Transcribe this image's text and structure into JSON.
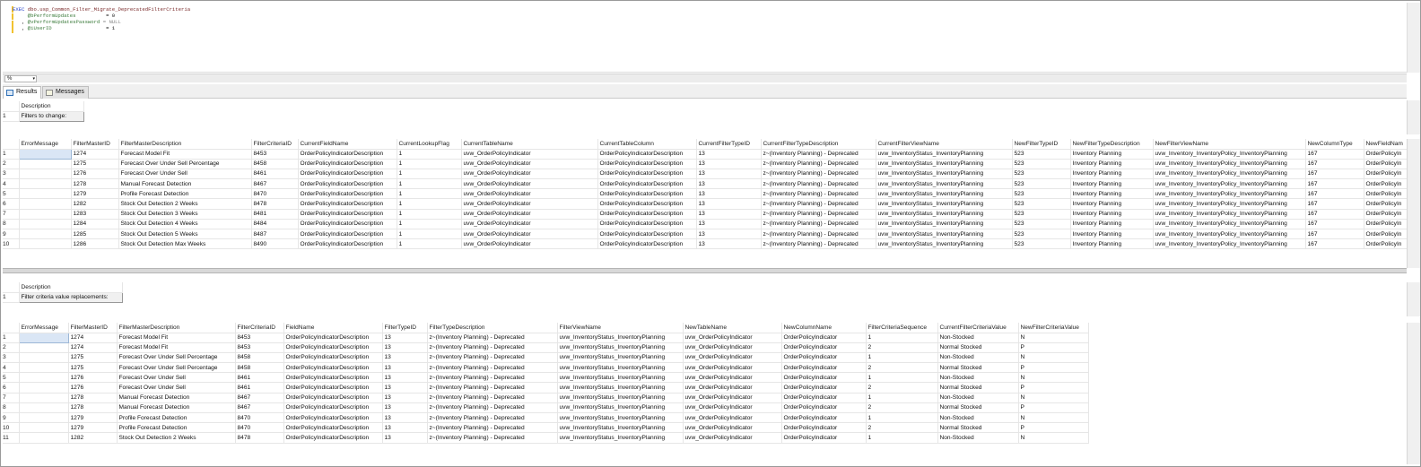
{
  "editor": {
    "line1_kw": "EXEC",
    "line1_proc": "dbo.usp_Common_Filter_Migrate_DeprecatedFilterCriteria",
    "line2_var": "@bPerformUpdates",
    "line2_val": "= 0",
    "line3_var": "@vPerformUpdatesPassword",
    "line3_val": "= NULL",
    "line4_var": "@iUserID",
    "line4_val": "= 1"
  },
  "zoom": {
    "value": "%"
  },
  "tabs": {
    "results": "Results",
    "messages": "Messages"
  },
  "grid1": {
    "header": "Description",
    "rows": [
      {
        "n": "1",
        "value": "Filters to change:"
      }
    ]
  },
  "grid2": {
    "headers": [
      "ErrorMessage",
      "FilterMasterID",
      "FilterMasterDescription",
      "FilterCriteriaID",
      "CurrentFieldName",
      "CurrentLookupFlag",
      "CurrentTableName",
      "CurrentTableColumn",
      "CurrentFilterTypeID",
      "CurrentFilterTypeDescription",
      "CurrentFilterViewName",
      "NewFilterTypeID",
      "NewFilterTypeDescription",
      "NewFilterViewName",
      "NewColumnType",
      "NewFieldNam"
    ],
    "rows": [
      [
        "1",
        "",
        "1274",
        "Forecast Model Fit",
        "8453",
        "OrderPolicyIndicatorDescription",
        "1",
        "uvw_OrderPolicyIndicator",
        "OrderPolicyIndicatorDescription",
        "13",
        "z~(Inventory Planning) - Deprecated",
        "uvw_InventoryStatus_InventoryPlanning",
        "523",
        "Inventory Planning",
        "uvw_Inventory_InventoryPolicy_InventoryPlanning",
        "167",
        "OrderPolicyIn"
      ],
      [
        "2",
        "",
        "1275",
        "Forecast Over Under Sell Percentage",
        "8458",
        "OrderPolicyIndicatorDescription",
        "1",
        "uvw_OrderPolicyIndicator",
        "OrderPolicyIndicatorDescription",
        "13",
        "z~(Inventory Planning) - Deprecated",
        "uvw_InventoryStatus_InventoryPlanning",
        "523",
        "Inventory Planning",
        "uvw_Inventory_InventoryPolicy_InventoryPlanning",
        "167",
        "OrderPolicyIn"
      ],
      [
        "3",
        "",
        "1276",
        "Forecast Over Under Sell",
        "8461",
        "OrderPolicyIndicatorDescription",
        "1",
        "uvw_OrderPolicyIndicator",
        "OrderPolicyIndicatorDescription",
        "13",
        "z~(Inventory Planning) - Deprecated",
        "uvw_InventoryStatus_InventoryPlanning",
        "523",
        "Inventory Planning",
        "uvw_Inventory_InventoryPolicy_InventoryPlanning",
        "167",
        "OrderPolicyIn"
      ],
      [
        "4",
        "",
        "1278",
        "Manual Forecast Detection",
        "8467",
        "OrderPolicyIndicatorDescription",
        "1",
        "uvw_OrderPolicyIndicator",
        "OrderPolicyIndicatorDescription",
        "13",
        "z~(Inventory Planning) - Deprecated",
        "uvw_InventoryStatus_InventoryPlanning",
        "523",
        "Inventory Planning",
        "uvw_Inventory_InventoryPolicy_InventoryPlanning",
        "167",
        "OrderPolicyIn"
      ],
      [
        "5",
        "",
        "1279",
        "Profile Forecast Detection",
        "8470",
        "OrderPolicyIndicatorDescription",
        "1",
        "uvw_OrderPolicyIndicator",
        "OrderPolicyIndicatorDescription",
        "13",
        "z~(Inventory Planning) - Deprecated",
        "uvw_InventoryStatus_InventoryPlanning",
        "523",
        "Inventory Planning",
        "uvw_Inventory_InventoryPolicy_InventoryPlanning",
        "167",
        "OrderPolicyIn"
      ],
      [
        "6",
        "",
        "1282",
        "Stock Out Detection 2 Weeks",
        "8478",
        "OrderPolicyIndicatorDescription",
        "1",
        "uvw_OrderPolicyIndicator",
        "OrderPolicyIndicatorDescription",
        "13",
        "z~(Inventory Planning) - Deprecated",
        "uvw_InventoryStatus_InventoryPlanning",
        "523",
        "Inventory Planning",
        "uvw_Inventory_InventoryPolicy_InventoryPlanning",
        "167",
        "OrderPolicyIn"
      ],
      [
        "7",
        "",
        "1283",
        "Stock Out Detection 3 Weeks",
        "8481",
        "OrderPolicyIndicatorDescription",
        "1",
        "uvw_OrderPolicyIndicator",
        "OrderPolicyIndicatorDescription",
        "13",
        "z~(Inventory Planning) - Deprecated",
        "uvw_InventoryStatus_InventoryPlanning",
        "523",
        "Inventory Planning",
        "uvw_Inventory_InventoryPolicy_InventoryPlanning",
        "167",
        "OrderPolicyIn"
      ],
      [
        "8",
        "",
        "1284",
        "Stock Out Detection 4 Weeks",
        "8484",
        "OrderPolicyIndicatorDescription",
        "1",
        "uvw_OrderPolicyIndicator",
        "OrderPolicyIndicatorDescription",
        "13",
        "z~(Inventory Planning) - Deprecated",
        "uvw_InventoryStatus_InventoryPlanning",
        "523",
        "Inventory Planning",
        "uvw_Inventory_InventoryPolicy_InventoryPlanning",
        "167",
        "OrderPolicyIn"
      ],
      [
        "9",
        "",
        "1285",
        "Stock Out Detection 5 Weeks",
        "8487",
        "OrderPolicyIndicatorDescription",
        "1",
        "uvw_OrderPolicyIndicator",
        "OrderPolicyIndicatorDescription",
        "13",
        "z~(Inventory Planning) - Deprecated",
        "uvw_InventoryStatus_InventoryPlanning",
        "523",
        "Inventory Planning",
        "uvw_Inventory_InventoryPolicy_InventoryPlanning",
        "167",
        "OrderPolicyIn"
      ],
      [
        "10",
        "",
        "1286",
        "Stock Out Detection Max Weeks",
        "8490",
        "OrderPolicyIndicatorDescription",
        "1",
        "uvw_OrderPolicyIndicator",
        "OrderPolicyIndicatorDescription",
        "13",
        "z~(Inventory Planning) - Deprecated",
        "uvw_InventoryStatus_InventoryPlanning",
        "523",
        "Inventory Planning",
        "uvw_Inventory_InventoryPolicy_InventoryPlanning",
        "167",
        "OrderPolicyIn"
      ]
    ]
  },
  "grid3": {
    "header": "Description",
    "rows": [
      {
        "n": "1",
        "value": "Filter criteria value replacements:"
      }
    ]
  },
  "grid4": {
    "headers": [
      "ErrorMessage",
      "FilterMasterID",
      "FilterMasterDescription",
      "FilterCriteriaID",
      "FieldName",
      "FilterTypeID",
      "FilterTypeDescription",
      "FilterViewName",
      "NewTableName",
      "NewColumnName",
      "FilterCriteriaSequence",
      "CurrentFilterCriteriaValue",
      "NewFilterCriteriaValue"
    ],
    "rows": [
      [
        "1",
        "",
        "1274",
        "Forecast Model Fit",
        "8453",
        "OrderPolicyIndicatorDescription",
        "13",
        "z~(Inventory Planning) - Deprecated",
        "uvw_InventoryStatus_InventoryPlanning",
        "uvw_OrderPolicyIndicator",
        "OrderPolicyIndicator",
        "1",
        "Non-Stocked",
        "N"
      ],
      [
        "2",
        "",
        "1274",
        "Forecast Model Fit",
        "8453",
        "OrderPolicyIndicatorDescription",
        "13",
        "z~(Inventory Planning) - Deprecated",
        "uvw_InventoryStatus_InventoryPlanning",
        "uvw_OrderPolicyIndicator",
        "OrderPolicyIndicator",
        "2",
        "Normal Stocked",
        "P"
      ],
      [
        "3",
        "",
        "1275",
        "Forecast Over Under Sell Percentage",
        "8458",
        "OrderPolicyIndicatorDescription",
        "13",
        "z~(Inventory Planning) - Deprecated",
        "uvw_InventoryStatus_InventoryPlanning",
        "uvw_OrderPolicyIndicator",
        "OrderPolicyIndicator",
        "1",
        "Non-Stocked",
        "N"
      ],
      [
        "4",
        "",
        "1275",
        "Forecast Over Under Sell Percentage",
        "8458",
        "OrderPolicyIndicatorDescription",
        "13",
        "z~(Inventory Planning) - Deprecated",
        "uvw_InventoryStatus_InventoryPlanning",
        "uvw_OrderPolicyIndicator",
        "OrderPolicyIndicator",
        "2",
        "Normal Stocked",
        "P"
      ],
      [
        "5",
        "",
        "1276",
        "Forecast Over Under Sell",
        "8461",
        "OrderPolicyIndicatorDescription",
        "13",
        "z~(Inventory Planning) - Deprecated",
        "uvw_InventoryStatus_InventoryPlanning",
        "uvw_OrderPolicyIndicator",
        "OrderPolicyIndicator",
        "1",
        "Non-Stocked",
        "N"
      ],
      [
        "6",
        "",
        "1276",
        "Forecast Over Under Sell",
        "8461",
        "OrderPolicyIndicatorDescription",
        "13",
        "z~(Inventory Planning) - Deprecated",
        "uvw_InventoryStatus_InventoryPlanning",
        "uvw_OrderPolicyIndicator",
        "OrderPolicyIndicator",
        "2",
        "Normal Stocked",
        "P"
      ],
      [
        "7",
        "",
        "1278",
        "Manual Forecast Detection",
        "8467",
        "OrderPolicyIndicatorDescription",
        "13",
        "z~(Inventory Planning) - Deprecated",
        "uvw_InventoryStatus_InventoryPlanning",
        "uvw_OrderPolicyIndicator",
        "OrderPolicyIndicator",
        "1",
        "Non-Stocked",
        "N"
      ],
      [
        "8",
        "",
        "1278",
        "Manual Forecast Detection",
        "8467",
        "OrderPolicyIndicatorDescription",
        "13",
        "z~(Inventory Planning) - Deprecated",
        "uvw_InventoryStatus_InventoryPlanning",
        "uvw_OrderPolicyIndicator",
        "OrderPolicyIndicator",
        "2",
        "Normal Stocked",
        "P"
      ],
      [
        "9",
        "",
        "1279",
        "Profile Forecast Detection",
        "8470",
        "OrderPolicyIndicatorDescription",
        "13",
        "z~(Inventory Planning) - Deprecated",
        "uvw_InventoryStatus_InventoryPlanning",
        "uvw_OrderPolicyIndicator",
        "OrderPolicyIndicator",
        "1",
        "Non-Stocked",
        "N"
      ],
      [
        "10",
        "",
        "1279",
        "Profile Forecast Detection",
        "8470",
        "OrderPolicyIndicatorDescription",
        "13",
        "z~(Inventory Planning) - Deprecated",
        "uvw_InventoryStatus_InventoryPlanning",
        "uvw_OrderPolicyIndicator",
        "OrderPolicyIndicator",
        "2",
        "Normal Stocked",
        "P"
      ],
      [
        "11",
        "",
        "1282",
        "Stock Out Detection 2 Weeks",
        "8478",
        "OrderPolicyIndicatorDescription",
        "13",
        "z~(Inventory Planning) - Deprecated",
        "uvw_InventoryStatus_InventoryPlanning",
        "uvw_OrderPolicyIndicator",
        "OrderPolicyIndicator",
        "1",
        "Non-Stocked",
        "N"
      ]
    ]
  }
}
